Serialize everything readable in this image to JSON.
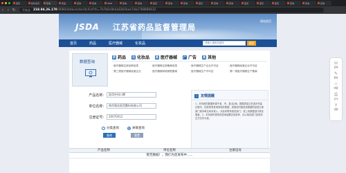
{
  "browser": {
    "tabs": [
      "首页",
      "新标签页",
      "查询",
      "药品",
      "查询",
      "查询",
      "WEB",
      "查询",
      "查询",
      "首页",
      "查询",
      "查询",
      "首页",
      "查询",
      "查询",
      "首页",
      "首页",
      "首页",
      "查询",
      "查询",
      "查询"
    ],
    "insecure_label": "不安全",
    "url_host": "218.94.26.170",
    "url_path": ":8080/datacenter/dc/list?ts=7b7b6c8b4a83b5bee7ab2788886632",
    "nav_back": "‹",
    "nav_forward": "›",
    "nav_reload": "↻"
  },
  "header": {
    "logo_abbr": "JSDA",
    "title": "江苏省药品监督管理局",
    "top_link": "网站首页"
  },
  "nav": {
    "items": [
      "首页",
      "药品",
      "医疗器械",
      "化妆品"
    ],
    "search_placeholder": "请输入搜索关键字",
    "search_button": "搜索"
  },
  "query_box": {
    "label": "数据查询"
  },
  "categories": {
    "heads": [
      {
        "icon": "药",
        "label": "药品"
      },
      {
        "icon": "化",
        "label": "化妆品"
      },
      {
        "icon": "医",
        "label": "医疗器械"
      },
      {
        "icon": "广",
        "label": "广告"
      },
      {
        "icon": "其",
        "label": "其他"
      }
    ],
    "links": [
      "医疗器械注册品种信息",
      "医疗器械注册备案信息",
      "医疗器械生产企业许可证",
      "医疗器械经营企业许可证",
      "第三类医疗器械经营企业",
      "医疗器械网络销售备案",
      "医疗器械生产许可证",
      "第一类医疗器械生产备案"
    ]
  },
  "form": {
    "fields": [
      {
        "label": "产品名称:",
        "value": "医用外科口罩"
      },
      {
        "label": "单位名称:",
        "value": "南京奥佳医用敷料有限公司"
      },
      {
        "label": "注册证号:",
        "value": "20070012"
      }
    ],
    "radio_options": [
      {
        "label": "分类查询",
        "checked": false
      },
      {
        "label": "关联查询",
        "checked": true
      }
    ],
    "query_button": "查询",
    "reset_button": "重置"
  },
  "notice": {
    "title": "友情提醒",
    "body": "1、本系统的数据来源于省、市、县(区)局。数据质量正在逐步完善过程中，如发现有查询到相关数据，其原因可能是该数据的经营主管部门或本单位尚未录入，请及时联系相关部门，或上传数据进行核实更新。2、本系统所提供的查询结果仅供参考，请以相关部门发布的正式文件为准。"
  },
  "results": {
    "columns": [
      "产品名称",
      "单位名称",
      "注册证号"
    ],
    "empty_message": "暂无数据！，我们为您发布中......"
  },
  "side_tools": [
    {
      "icon": "☏",
      "label": "咨询"
    },
    {
      "icon": "✎",
      "label": "留言"
    },
    {
      "icon": "☆",
      "label": "收藏"
    },
    {
      "icon": "⎙",
      "label": "打印"
    },
    {
      "icon": "↑",
      "label": "顶部"
    }
  ]
}
